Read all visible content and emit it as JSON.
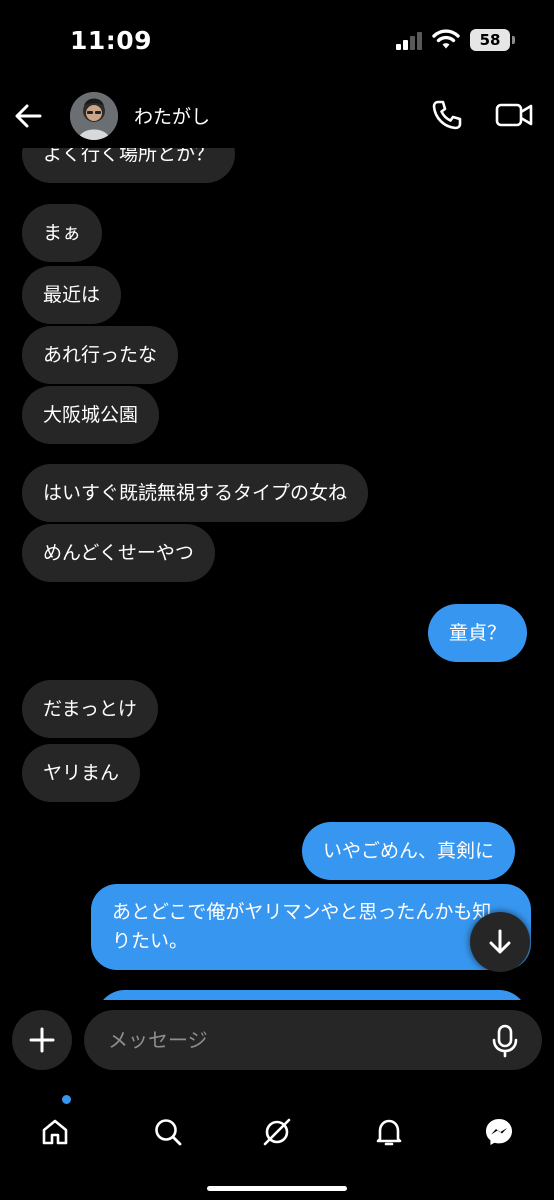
{
  "status_bar": {
    "time": "11:09",
    "battery": "58"
  },
  "header": {
    "contact_name": "わたがし"
  },
  "messages": [
    {
      "side": "in",
      "text": "よく行く場所とか？"
    },
    {
      "side": "in",
      "text": "まぁ"
    },
    {
      "side": "in",
      "text": "最近は"
    },
    {
      "side": "in",
      "text": "あれ行ったな"
    },
    {
      "side": "in",
      "text": "大阪城公園"
    },
    {
      "side": "in",
      "text": "はいすぐ既読無視するタイプの女ね"
    },
    {
      "side": "in",
      "text": "めんどくせーやつ"
    },
    {
      "side": "out",
      "text": "童貞？"
    },
    {
      "side": "in",
      "text": "だまっとけ"
    },
    {
      "side": "in",
      "text": "ヤリまん"
    },
    {
      "side": "out",
      "text": "いやごめん、真剣に"
    },
    {
      "side": "out",
      "text": "あとどこで俺がヤリマンやと思ったんかも知りたい。"
    }
  ],
  "composer": {
    "placeholder": "メッセージ"
  },
  "colors": {
    "background": "#000000",
    "incoming_bubble": "#262626",
    "outgoing_bubble": "#3797f0",
    "placeholder_text": "#8e8e8e"
  },
  "icons": {
    "header": [
      "back-arrow-icon",
      "phone-icon",
      "video-camera-icon"
    ],
    "composer": [
      "plus-icon",
      "microphone-icon"
    ],
    "tabs": [
      "home-icon",
      "search-icon",
      "explore-compass-icon",
      "bell-icon",
      "messenger-icon"
    ]
  }
}
